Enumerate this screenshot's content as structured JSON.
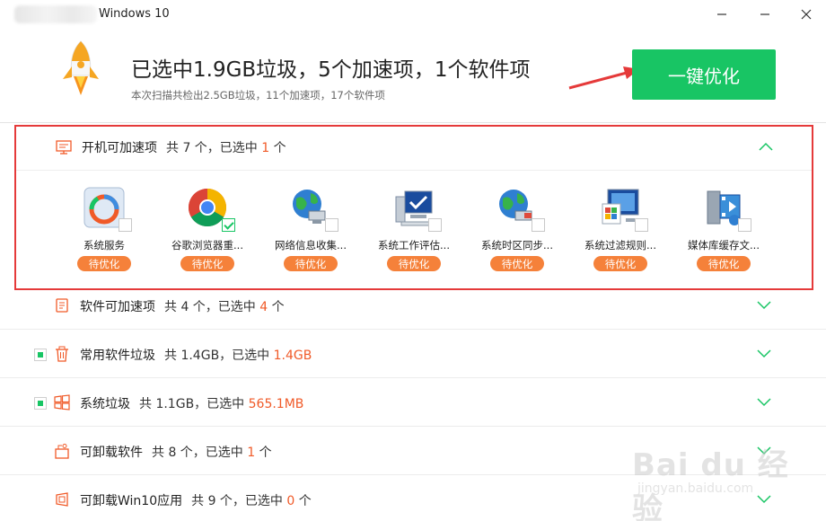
{
  "window": {
    "title": "Windows 10"
  },
  "header": {
    "headline": "已选中1.9GB垃圾，5个加速项，1个软件项",
    "subline": "本次扫描共检出2.5GB垃圾，11个加速项，17个软件项",
    "action_button": "一键优化"
  },
  "colors": {
    "accent_green": "#18c564",
    "highlight_orange": "#f05a28",
    "tag_orange": "#f5813a",
    "annotation_red": "#e53a3a"
  },
  "expanded_section": {
    "title": "开机可加速项",
    "stat_prefix": "共 7 个，已选中",
    "selected": "1",
    "stat_suffix": "个",
    "items": [
      {
        "name": "系统服务",
        "tag": "待优化",
        "checked": false,
        "icon": "system-service-icon"
      },
      {
        "name": "谷歌浏览器重...",
        "tag": "待优化",
        "checked": true,
        "icon": "chrome-icon"
      },
      {
        "name": "网络信息收集...",
        "tag": "待优化",
        "checked": false,
        "icon": "network-globe-icon"
      },
      {
        "name": "系统工作评估...",
        "tag": "待优化",
        "checked": false,
        "icon": "computer-check-icon"
      },
      {
        "name": "系统时区同步...",
        "tag": "待优化",
        "checked": false,
        "icon": "timezone-globe-icon"
      },
      {
        "name": "系统过滤规则...",
        "tag": "待优化",
        "checked": false,
        "icon": "filter-rules-icon"
      },
      {
        "name": "媒体库缓存文...",
        "tag": "待优化",
        "checked": false,
        "icon": "media-library-icon"
      }
    ]
  },
  "sections": [
    {
      "title": "软件可加速项",
      "stat_prefix": "共 4 个，已选中",
      "selected": "4",
      "stat_suffix": "个",
      "icon": "software-speed-icon",
      "has_checkbox": false
    },
    {
      "title": "常用软件垃圾",
      "stat_prefix": "共 1.4GB，已选中",
      "selected": "1.4GB",
      "stat_suffix": "",
      "icon": "trash-icon",
      "has_checkbox": true
    },
    {
      "title": "系统垃圾",
      "stat_prefix": "共 1.1GB，已选中",
      "selected": "565.1MB",
      "stat_suffix": "",
      "icon": "windows-icon",
      "has_checkbox": true
    },
    {
      "title": "可卸载软件",
      "stat_prefix": "共 8 个，已选中",
      "selected": "1",
      "stat_suffix": "个",
      "icon": "uninstall-box-icon",
      "has_checkbox": false
    },
    {
      "title": "可卸载Win10应用",
      "stat_prefix": "共 9 个，已选中",
      "selected": "0",
      "stat_suffix": "个",
      "icon": "win10-app-icon",
      "has_checkbox": false
    }
  ],
  "watermark": {
    "brand": "Bai du 经验",
    "url": "jingyan.baidu.com"
  }
}
